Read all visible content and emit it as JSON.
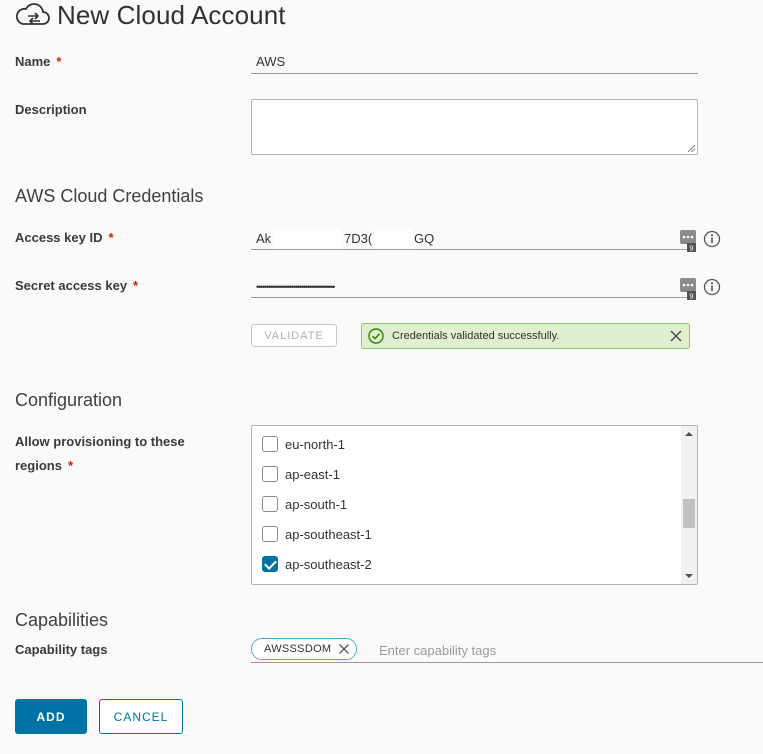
{
  "header": {
    "title": "New Cloud Account",
    "icon": "cloud-sync-icon"
  },
  "form": {
    "name": {
      "label": "Name",
      "required": "*",
      "value": "AWS"
    },
    "description": {
      "label": "Description",
      "value": ""
    }
  },
  "credentials": {
    "section_title": "AWS Cloud Credentials",
    "access_key": {
      "label": "Access key ID",
      "required": "*",
      "value_part1": "Ak",
      "value_part2": "7D3(",
      "value_part3": "GQ"
    },
    "secret_key": {
      "label": "Secret access key",
      "required": "*",
      "value": "••••••••••••••••••••••••••••••••••••••••"
    },
    "validate_label": "VALIDATE",
    "alert": {
      "text": "Credentials validated successfully.",
      "color": "#dff0d0"
    }
  },
  "configuration": {
    "section_title": "Configuration",
    "regions_label": "Allow provisioning to these regions",
    "required": "*",
    "regions": [
      {
        "label": "eu-north-1",
        "checked": false
      },
      {
        "label": "ap-east-1",
        "checked": false
      },
      {
        "label": "ap-south-1",
        "checked": false
      },
      {
        "label": "ap-southeast-1",
        "checked": false
      },
      {
        "label": "ap-southeast-2",
        "checked": true
      }
    ]
  },
  "capabilities": {
    "section_title": "Capabilities",
    "tags_label": "Capability tags",
    "tags": [
      {
        "label": "AWSSSDOM"
      }
    ],
    "tags_placeholder": "Enter capability tags"
  },
  "actions": {
    "add_label": "ADD",
    "cancel_label": "CANCEL",
    "primary_color": "#0072a3"
  }
}
